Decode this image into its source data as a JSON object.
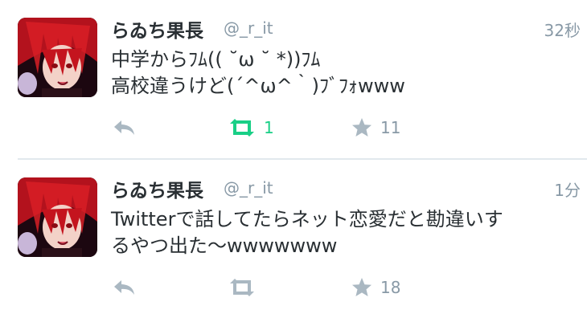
{
  "tweets": [
    {
      "name": "らゐち果長",
      "handle": "@_r_it",
      "time": "32秒",
      "lines": [
        "中学からﾌﾑ(( ˘ω ˘ *))ﾌﾑ",
        "高校違うけど(´^ω^｀)ﾌﾞﾌｫwww"
      ],
      "retweets": "1",
      "retweeted": true,
      "favorites": "11",
      "icons": {
        "reply": "reply-icon",
        "retweet": "retweet-icon",
        "favorite": "star-icon"
      }
    },
    {
      "name": "らゐち果長",
      "handle": "@_r_it",
      "time": "1分",
      "lines": [
        "Twitterで話してたらネット恋愛だと勘違いす",
        "るやつ出た〜wwwwwww"
      ],
      "retweets": "",
      "retweeted": false,
      "favorites": "18",
      "icons": {
        "reply": "reply-icon",
        "retweet": "retweet-icon",
        "favorite": "star-icon"
      }
    }
  ],
  "colors": {
    "name": "#292f33",
    "meta": "#8899a6",
    "icon_inactive": "#aab8c2",
    "retweet_active": "#19cf86",
    "divider": "#e1e8ed"
  }
}
